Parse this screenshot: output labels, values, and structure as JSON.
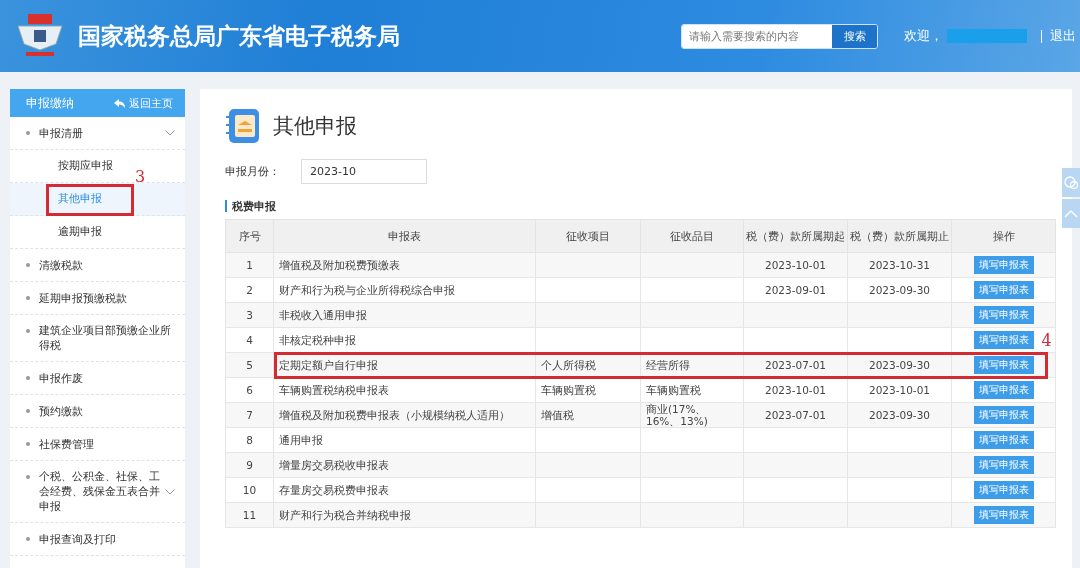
{
  "header": {
    "site_title": "国家税务总局广东省电子税务局",
    "search": {
      "placeholder": "请输入需要搜索的内容",
      "button": "搜索"
    },
    "welcome": "欢迎，",
    "logout": "退出"
  },
  "sidebar": {
    "title": "申报缴纳",
    "back_link": "返回主页",
    "items": [
      {
        "label": "申报清册",
        "expandable": true,
        "children": [
          {
            "label": "按期应申报",
            "selected": false
          },
          {
            "label": "其他申报",
            "selected": true,
            "callout": "3"
          },
          {
            "label": "逾期申报",
            "selected": false
          }
        ]
      },
      {
        "label": "清缴税款",
        "expandable": false
      },
      {
        "label": "延期申报预缴税款",
        "expandable": false
      },
      {
        "label": "建筑企业项目部预缴企业所得税",
        "expandable": false
      },
      {
        "label": "申报作废",
        "expandable": false
      },
      {
        "label": "预约缴款",
        "expandable": false
      },
      {
        "label": "社保费管理",
        "expandable": false
      },
      {
        "label": "个税、公积金、社保、工会经费、残保金五表合并申报",
        "expandable": true
      },
      {
        "label": "申报查询及打印",
        "expandable": false
      }
    ]
  },
  "page": {
    "title": "其他申报",
    "month_label": "申报月份：",
    "month_value": "2023-10",
    "section_title": "税费申报"
  },
  "table": {
    "columns": [
      "序号",
      "申报表",
      "征收项目",
      "征收品目",
      "税（费）款所属期起",
      "税（费）款所属期止",
      "操作"
    ],
    "rows": [
      {
        "no": "1",
        "form": "增值税及附加税费预缴表",
        "item": "",
        "category": "",
        "start": "2023-10-01",
        "end": "2023-10-31",
        "action": "填写申报表"
      },
      {
        "no": "2",
        "form": "财产和行为税与企业所得税综合申报",
        "item": "",
        "category": "",
        "start": "2023-09-01",
        "end": "2023-09-30",
        "action": "填写申报表"
      },
      {
        "no": "3",
        "form": "非税收入通用申报",
        "item": "",
        "category": "",
        "start": "",
        "end": "",
        "action": "填写申报表"
      },
      {
        "no": "4",
        "form": "非核定税种申报",
        "item": "",
        "category": "",
        "start": "",
        "end": "",
        "action": "填写申报表"
      },
      {
        "no": "5",
        "form": "定期定额户自行申报",
        "item": "个人所得税",
        "category": "经营所得",
        "start": "2023-07-01",
        "end": "2023-09-30",
        "action": "填写申报表",
        "callout": "4"
      },
      {
        "no": "6",
        "form": "车辆购置税纳税申报表",
        "item": "车辆购置税",
        "category": "车辆购置税",
        "start": "2023-10-01",
        "end": "2023-10-01",
        "action": "填写申报表"
      },
      {
        "no": "7",
        "form": "增值税及附加税费申报表（小规模纳税人适用）",
        "item": "增值税",
        "category": "商业(17%、16%、13%)",
        "start": "2023-07-01",
        "end": "2023-09-30",
        "action": "填写申报表"
      },
      {
        "no": "8",
        "form": "通用申报",
        "item": "",
        "category": "",
        "start": "",
        "end": "",
        "action": "填写申报表"
      },
      {
        "no": "9",
        "form": "增量房交易税收申报表",
        "item": "",
        "category": "",
        "start": "",
        "end": "",
        "action": "填写申报表"
      },
      {
        "no": "10",
        "form": "存量房交易税费申报表",
        "item": "",
        "category": "",
        "start": "",
        "end": "",
        "action": "填写申报表"
      },
      {
        "no": "11",
        "form": "财产和行为税合并纳税申报",
        "item": "",
        "category": "",
        "start": "",
        "end": "",
        "action": "填写申报表"
      }
    ]
  }
}
